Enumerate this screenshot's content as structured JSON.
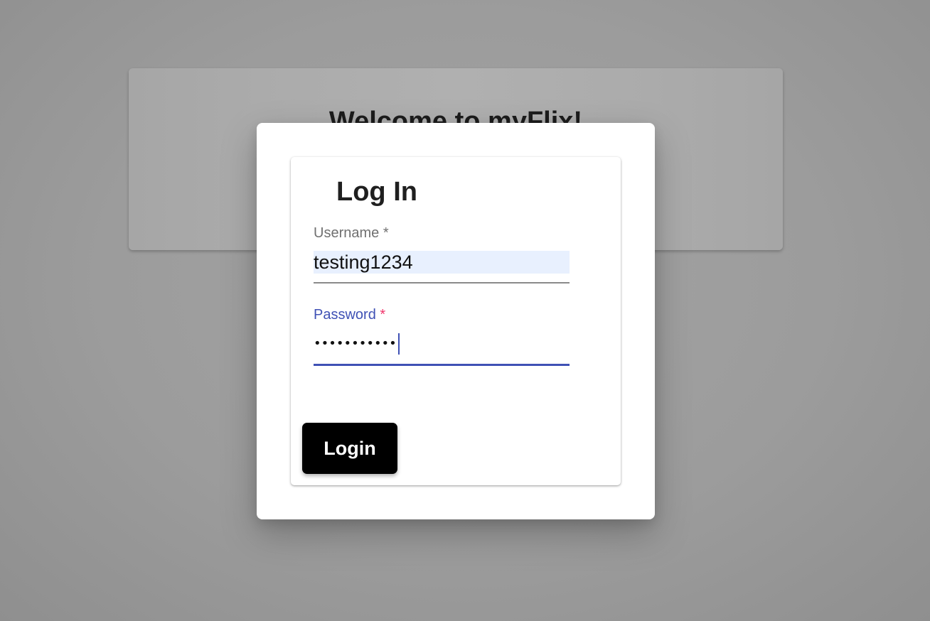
{
  "background": {
    "welcome_title": "Welcome to myFlix!"
  },
  "login_form": {
    "title": "Log In",
    "username": {
      "label": "Username",
      "required_mark": "*",
      "value": "testing1234"
    },
    "password": {
      "label": "Password",
      "required_mark": "*",
      "masked_value": "•••••••••••",
      "state": "focused"
    },
    "login_button_label": "Login"
  },
  "colors": {
    "focus_accent": "#3f51b5",
    "required_star_focused": "#f0356b",
    "autofill_background": "#e8f0fe",
    "button_background": "#000000"
  }
}
